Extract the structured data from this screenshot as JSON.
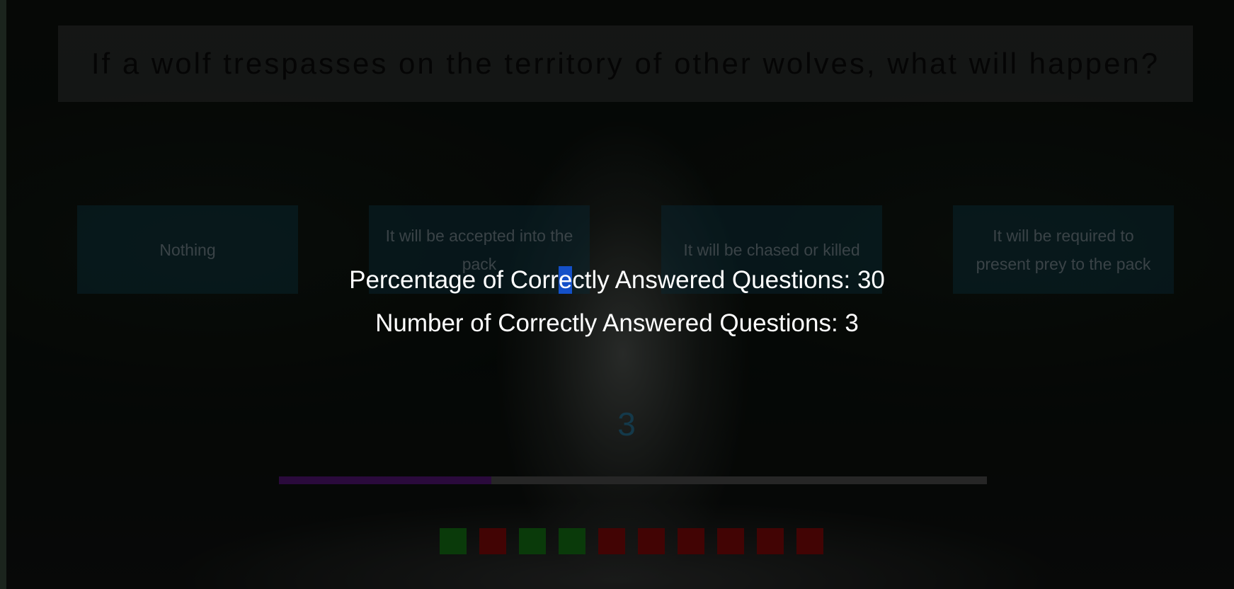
{
  "question": {
    "text": "If a wolf trespasses on the territory of other wolves, what will happen?"
  },
  "answers": [
    {
      "label": "Nothing"
    },
    {
      "label": "It will be accepted into the pack"
    },
    {
      "label": "It will be chased or killed"
    },
    {
      "label": "It will be required to present prey to the pack"
    }
  ],
  "results": {
    "percentage_pre": "Percentage of Corr",
    "percentage_sel": "e",
    "percentage_post": "ctly Answered Questions: 30",
    "number_line": "Number of Correctly Answered Questions: 3"
  },
  "counter": "3",
  "progress": {
    "fraction": 0.3,
    "fill_color": "#2a0a3c",
    "track_color": "#262626"
  },
  "question_history": [
    {
      "status": "correct"
    },
    {
      "status": "wrong"
    },
    {
      "status": "correct"
    },
    {
      "status": "correct"
    },
    {
      "status": "wrong"
    },
    {
      "status": "wrong"
    },
    {
      "status": "wrong"
    },
    {
      "status": "wrong"
    },
    {
      "status": "wrong"
    },
    {
      "status": "wrong"
    }
  ],
  "colors": {
    "correct": "#0a3a0a",
    "wrong": "#420404",
    "selection": "#1450c8"
  }
}
